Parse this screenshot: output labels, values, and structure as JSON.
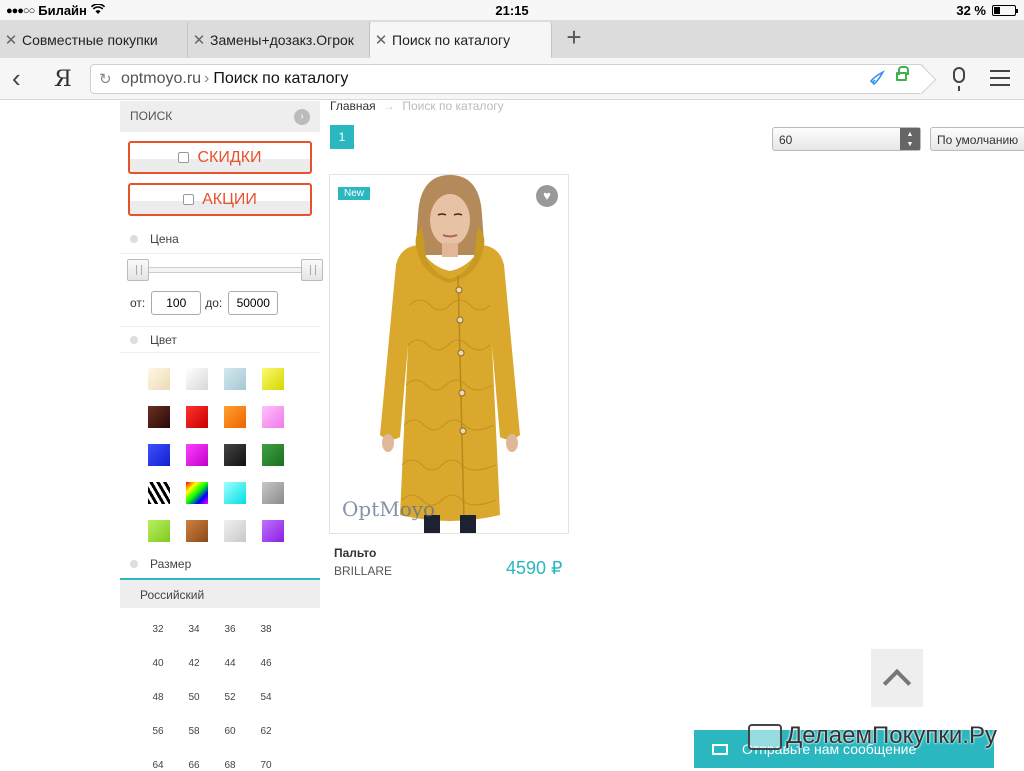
{
  "status": {
    "carrier": "Билайн",
    "signal_dots": "●●●○○",
    "time": "21:15",
    "battery_text": "32 %",
    "battery_level": 0.32
  },
  "tabs": [
    {
      "title": "Совместные покупки",
      "close": "✕"
    },
    {
      "title": "Замены+дозакз.Огрок",
      "close": "✕"
    },
    {
      "title": "Поиск по каталогу",
      "close": "✕"
    }
  ],
  "newtab_label": "+",
  "navbar": {
    "back": "‹",
    "ya_label": "Я",
    "domain": "optmoyo.ru",
    "separator": "›",
    "page_title": "Поиск по каталогу"
  },
  "sidebar": {
    "search_label": "ПОИСК",
    "discounts_label": "СКИДКИ",
    "promos_label": "АКЦИИ",
    "price_title": "Цена",
    "price_from_label": "от:",
    "price_from": "100",
    "price_to_label": "до:",
    "price_to": "50000",
    "color_title": "Цвет",
    "colors": [
      "linear-gradient(135deg,#fff8e6,#ecd9b4)",
      "linear-gradient(135deg,#ffffff,#d8d8d8)",
      "linear-gradient(135deg,#d4e8f0,#a6c8d4)",
      "linear-gradient(135deg,#fafa70,#d6d600)",
      "linear-gradient(135deg,#6a2e24,#2a0a06)",
      "linear-gradient(135deg,#ff3030,#c80000)",
      "linear-gradient(135deg,#ffa030,#ee6400)",
      "linear-gradient(135deg,#ffc0ff,#f07ae8)",
      "linear-gradient(135deg,#4050ff,#1020d0)",
      "linear-gradient(135deg,#ff40ff,#c000c8)",
      "linear-gradient(135deg,#444444,#111111)",
      "linear-gradient(135deg,#40a040,#1a7020)",
      "repeating-linear-gradient(60deg,#000 0 3px,#fff 3px 6px)",
      "linear-gradient(135deg,#ff0000,#ffff00,#00ff00,#0000ff,#ff00ff)",
      "linear-gradient(135deg,#a0ffff,#00e0e0)",
      "linear-gradient(135deg,#c8c8c8,#8a8a8a)",
      "linear-gradient(135deg,#b8f060,#80c820)",
      "linear-gradient(135deg,#d08040,#8a4a18)",
      "linear-gradient(135deg,#f0f0f0,#c8c8c8)",
      "linear-gradient(135deg,#c070ff,#8a20e0)"
    ],
    "size_title": "Размер",
    "size_system": "Российский",
    "sizes": [
      "32",
      "34",
      "36",
      "38",
      "40",
      "42",
      "44",
      "46",
      "48",
      "50",
      "52",
      "54",
      "56",
      "58",
      "60",
      "62",
      "64",
      "66",
      "68",
      "70"
    ]
  },
  "main": {
    "breadcrumb_home": "Главная",
    "breadcrumb_arrow": "→",
    "breadcrumb_current": "Поиск по каталогу",
    "page_number": "1",
    "per_page": "60",
    "sort": "По умолчанию"
  },
  "product": {
    "badge": "New",
    "name": "Пальто",
    "brand": "BRILLARE",
    "price": "4590 ₽",
    "watermark": "OptMoyo"
  },
  "chat_label": "Отправьте нам сообщение",
  "overlay_watermark": "ДелаемПокупки.Ру"
}
